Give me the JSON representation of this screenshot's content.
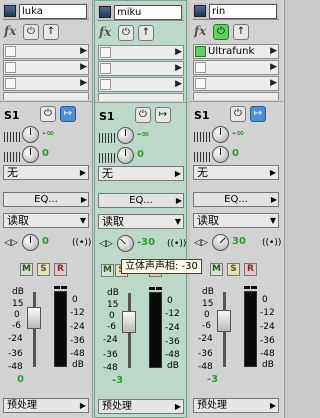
{
  "tracks": [
    {
      "name": "luka",
      "fx_label": "fx",
      "fx_slots": [
        "",
        "",
        "",
        ""
      ],
      "send_label": "S1",
      "send_volume": "-∞",
      "send_pan": "0",
      "send_target": "无",
      "eq_label": "EQ...",
      "automation_mode": "读取",
      "pan_value": "0",
      "mute": "M",
      "solo": "S",
      "record": "R",
      "fader_value": "0",
      "input_label": "预处理"
    },
    {
      "name": "miku",
      "fx_label": "fx",
      "fx_slots": [
        "",
        "",
        "",
        ""
      ],
      "send_label": "S1",
      "send_volume": "-∞",
      "send_pan": "0",
      "send_target": "无",
      "eq_label": "EQ...",
      "automation_mode": "读取",
      "pan_value": "-30",
      "mute": "M",
      "solo": "S",
      "record": "R",
      "fader_value": "-3",
      "input_label": "预处理"
    },
    {
      "name": "rin",
      "fx_label": "fx",
      "fx_slots": [
        "Ultrafunk",
        "",
        "",
        ""
      ],
      "send_label": "S1",
      "send_volume": "-∞",
      "send_pan": "0",
      "send_target": "无",
      "eq_label": "EQ...",
      "automation_mode": "读取",
      "pan_value": "30",
      "mute": "M",
      "solo": "S",
      "record": "R",
      "fader_value": "-3",
      "input_label": "预处理"
    }
  ],
  "db_scale_left": [
    "dB",
    "15",
    "0",
    "-6",
    "-24",
    "-36",
    "-48"
  ],
  "db_scale_right": [
    "0",
    "-12",
    "-24",
    "-36",
    "-48",
    "dB"
  ],
  "tooltip": "立体声声相: -30",
  "colors": {
    "selected_strip": "#bcd8c8",
    "value_green": "#2b9c2b",
    "power_on": "#5ad45a",
    "power_blue": "#4b8fd9"
  }
}
